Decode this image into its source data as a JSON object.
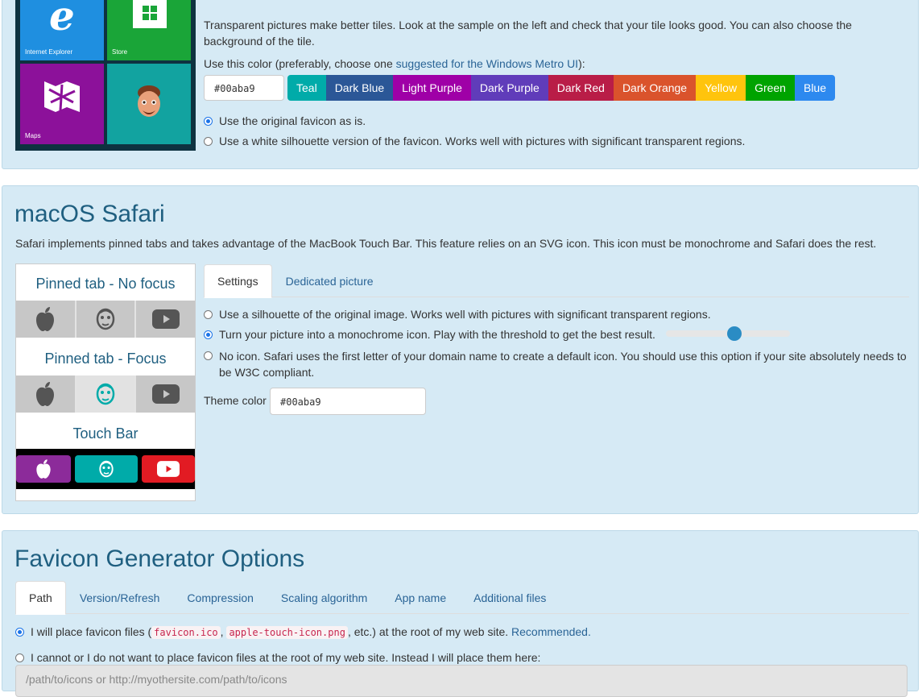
{
  "windows": {
    "tiles": [
      {
        "label": "Internet Explorer",
        "icon": "internet-explorer-icon",
        "color": "#1f8fe0"
      },
      {
        "label": "Store",
        "icon": "store-icon",
        "color": "#1aa538"
      },
      {
        "label": "Maps",
        "icon": "maps-icon",
        "color": "#8c119a"
      },
      {
        "label": "",
        "icon": "memoji-avatar-icon",
        "color": "#00aba9"
      }
    ],
    "description": "Transparent pictures make better tiles. Look at the sample on the left and check that your tile looks good. You can also choose the background of the tile.",
    "color_prompt_prefix": "Use this color (preferably, choose one ",
    "color_prompt_link": "suggested for the Windows Metro UI",
    "color_prompt_suffix": "):",
    "color_value": "#00aba9",
    "swatches": [
      {
        "label": "Teal",
        "color": "#00aba9"
      },
      {
        "label": "Dark Blue",
        "color": "#2b5797"
      },
      {
        "label": "Light Purple",
        "color": "#9f00a7"
      },
      {
        "label": "Dark Purple",
        "color": "#603cba"
      },
      {
        "label": "Dark Red",
        "color": "#b91d47"
      },
      {
        "label": "Dark Orange",
        "color": "#da532c"
      },
      {
        "label": "Yellow",
        "color": "#ffc40d"
      },
      {
        "label": "Green",
        "color": "#00a300"
      },
      {
        "label": "Blue",
        "color": "#2d89ef"
      }
    ],
    "option_original": "Use the original favicon as is.",
    "option_silhouette": "Use a white silhouette version of the favicon. Works well with pictures with significant transparent regions."
  },
  "safari": {
    "title": "macOS Safari",
    "description": "Safari implements pinned tabs and takes advantage of the MacBook Touch Bar. This feature relies on an SVG icon. This icon must be monochrome and Safari does the rest.",
    "preview_no_focus": "Pinned tab - No focus",
    "preview_focus": "Pinned tab - Focus",
    "preview_touch_bar": "Touch Bar",
    "tabs": [
      "Settings",
      "Dedicated picture"
    ],
    "option_silhouette": "Use a silhouette of the original image. Works well with pictures with significant transparent regions.",
    "option_monochrome": "Turn your picture into a monochrome icon. Play with the threshold to get the best result.",
    "option_no_icon": "No icon. Safari uses the first letter of your domain name to create a default icon. You should use this option if your site absolutely needs to be W3C compliant.",
    "threshold": 0.55,
    "theme_color_label": "Theme color",
    "theme_color_value": "#00aba9",
    "accent_color": "#2b8cc4"
  },
  "options": {
    "title": "Favicon Generator Options",
    "tabs": [
      "Path",
      "Version/Refresh",
      "Compression",
      "Scaling algorithm",
      "App name",
      "Additional files"
    ],
    "root_prefix": "I will place favicon files (",
    "root_code1": "favicon.ico",
    "root_sep": ",",
    "root_code2": "apple-touch-icon.png",
    "root_suffix": ", etc.) at the root of my web site.",
    "root_recommended": "Recommended.",
    "other_option": "I cannot or I do not want to place favicon files at the root of my web site. Instead I will place them here:",
    "path_placeholder": "/path/to/icons or http://myothersite.com/path/to/icons"
  }
}
